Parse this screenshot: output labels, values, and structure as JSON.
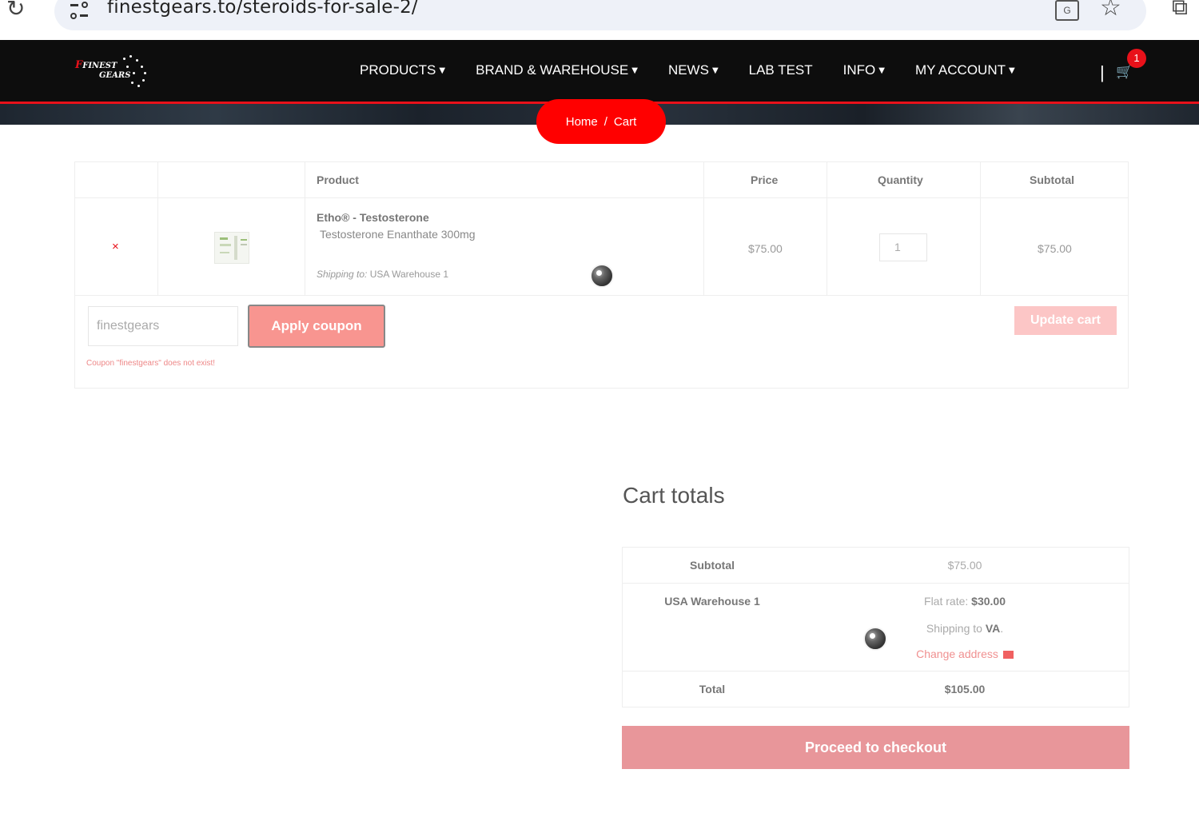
{
  "browser": {
    "url": "finestgears.to/steroids-for-sale-2/"
  },
  "site": {
    "logo_line1": "FINEST",
    "logo_line2": "GEARS",
    "nav": [
      {
        "label": "PRODUCTS",
        "has_dropdown": true
      },
      {
        "label": "BRAND & WAREHOUSE",
        "has_dropdown": true
      },
      {
        "label": "NEWS",
        "has_dropdown": true
      },
      {
        "label": "LAB TEST",
        "has_dropdown": false
      },
      {
        "label": "INFO",
        "has_dropdown": true
      },
      {
        "label": "MY ACCOUNT",
        "has_dropdown": true
      }
    ],
    "cart_count": "1",
    "accent_color": "#e8111a"
  },
  "breadcrumb": {
    "home": "Home",
    "separator": "/",
    "current": "Cart"
  },
  "cart": {
    "headers": {
      "product": "Product",
      "price": "Price",
      "quantity": "Quantity",
      "subtotal": "Subtotal"
    },
    "item": {
      "remove": "×",
      "name": "Etho® - Testosterone",
      "description": "Testosterone Enanthate 300mg",
      "shipping_label": "Shipping to:",
      "shipping_value": "USA Warehouse 1",
      "price": "$75.00",
      "quantity": "1",
      "subtotal": "$75.00"
    },
    "coupon_value": "finestgears",
    "apply_label": "Apply coupon",
    "coupon_error": "Coupon \"finestgears\" does not exist!",
    "update_label": "Update cart"
  },
  "totals": {
    "title": "Cart totals",
    "subtotal_label": "Subtotal",
    "subtotal_value": "$75.00",
    "shipping_label": "USA Warehouse 1",
    "flat_rate_label": "Flat rate:",
    "flat_rate_value": "$30.00",
    "shipping_to_label": "Shipping to",
    "shipping_to_value": "VA",
    "change_address": "Change address",
    "total_label": "Total",
    "total_value": "$105.00",
    "checkout_label": "Proceed to checkout"
  }
}
